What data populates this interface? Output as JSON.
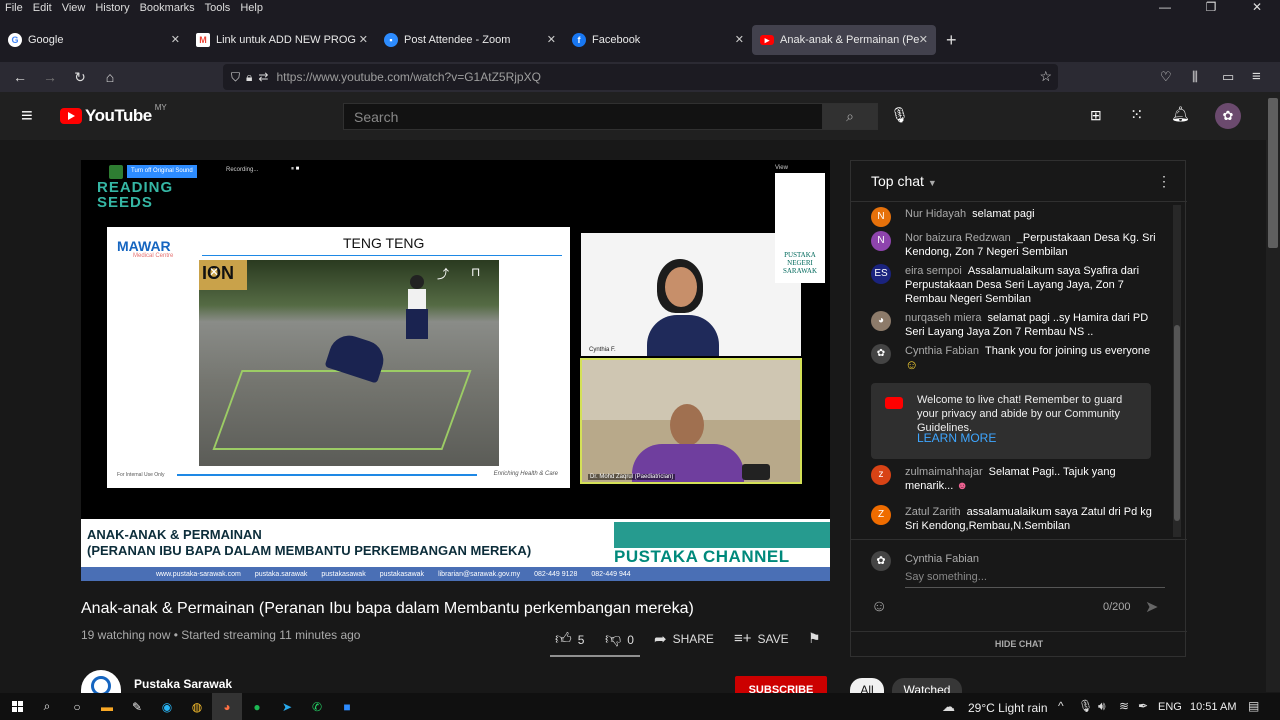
{
  "menu": [
    "File",
    "Edit",
    "View",
    "History",
    "Bookmarks",
    "Tools",
    "Help"
  ],
  "window_controls": [
    "—",
    "❐",
    "✕"
  ],
  "tabs": [
    {
      "label": "Google",
      "icon": "google-icon",
      "color": "#4285f4"
    },
    {
      "label": "Link untuk ADD NEW PROGRAM",
      "icon": "gmail-icon",
      "color": "#ea4335"
    },
    {
      "label": "Post Attendee - Zoom",
      "icon": "zoom-icon",
      "color": "#2d8cff"
    },
    {
      "label": "Facebook",
      "icon": "facebook-icon",
      "color": "#1877f2"
    },
    {
      "label": "Anak-anak & Permainan (Peranan",
      "icon": "youtube-icon",
      "color": "#ff0000"
    }
  ],
  "new_tab": "+",
  "url": "https://www.youtube.com/watch?v=G1AtZ5RjpXQ",
  "youtube": {
    "logo": "YouTube",
    "region": "MY",
    "search_placeholder": "Search"
  },
  "video": {
    "zoom_original_sound": "Turn off Original Sound",
    "zoom_recording": "Recording...",
    "zoom_view": "View",
    "reading_logo": "READING SEEDS",
    "slide_logo": "MAWAR",
    "slide_logo_sub": "Medical Centre",
    "slide_title": "TENG TENG",
    "slide_footer_left": "For Internal Use Only",
    "slide_footer_right": "Enriching Health & Care",
    "pustaka_logo": "PUSTAKA NEGERI SARAWAK",
    "speaker1": "Cynthia F.",
    "speaker2": "Dr. Mohd Zaqrul (Paediatrician)",
    "banner_line1": "ANAK-ANAK & PERMAINAN",
    "banner_line2": "(PERANAN IBU BAPA DALAM  MEMBANTU PERKEMBANGAN MEREKA)",
    "channel_brand": "PUSTAKA CHANNEL",
    "banner_links": [
      "www.pustaka-sarawak.com",
      "pustaka.sarawak",
      "pustakasawak",
      "pustakasawak",
      "librarian@sarawak.gov.my",
      "082-449 9128",
      "082-449 944"
    ]
  },
  "title": "Anak-anak & Permainan (Peranan Ibu bapa dalam Membantu perkembangan mereka)",
  "meta": "19 watching now • Started streaming 11 minutes ago",
  "actions": {
    "likes": "5",
    "dislikes": "0",
    "share": "SHARE",
    "save": "SAVE"
  },
  "channel": {
    "name": "Pustaka Sarawak",
    "subscribe": "SUBSCRIBE"
  },
  "chat": {
    "header": "Top chat",
    "messages": [
      {
        "author": "Nur Hidayah",
        "text": "selamat pagi",
        "initial": "N",
        "color": "#e6710b"
      },
      {
        "author": "Nor baizura Redzwan",
        "text": "_Perpustakaan Desa Kg. Sri Kendong, Zon 7 Negeri Sembilan",
        "initial": "N",
        "color": "#8e44ad"
      },
      {
        "author": "eira sempoi",
        "text": "Assalamualaikum saya Syafira dari Perpustakaan Desa Seri Layang Jaya, Zon 7 Rembau Negeri Sembilan",
        "initial": "ES",
        "color": "#1a237e"
      },
      {
        "author": "nurqaseh miera",
        "text": "selamat pagi ..sy Hamira dari PD Seri Layang Jaya Zon 7 Rembau NS ..",
        "initial": "",
        "color": "#8d7b6a"
      },
      {
        "author": "Cynthia Fabian",
        "text": "Thank you for joining us everyone",
        "initial": "",
        "color": "#444"
      },
      {
        "author": "zulmaimahhajar",
        "text": "Selamat Pagi.. Tajuk yang menarik...",
        "initial": "z",
        "color": "#d84315"
      },
      {
        "author": "Zatul Zarith",
        "text": "assalamualaikum saya Zatul dri Pd kg Sri Kendong,Rembau,N.Sembilan",
        "initial": "Z",
        "color": "#ef6c00"
      }
    ],
    "notice": "Welcome to live chat! Remember to guard your privacy and abide by our Community Guidelines.",
    "learn_more": "LEARN MORE",
    "input_user": "Cynthia Fabian",
    "input_placeholder": "Say something...",
    "counter": "0/200",
    "hide": "HIDE CHAT"
  },
  "chips": [
    "All",
    "Watched"
  ],
  "taskbar": {
    "weather": "29°C  Light rain",
    "lang": "ENG",
    "time": "10:51 AM"
  }
}
